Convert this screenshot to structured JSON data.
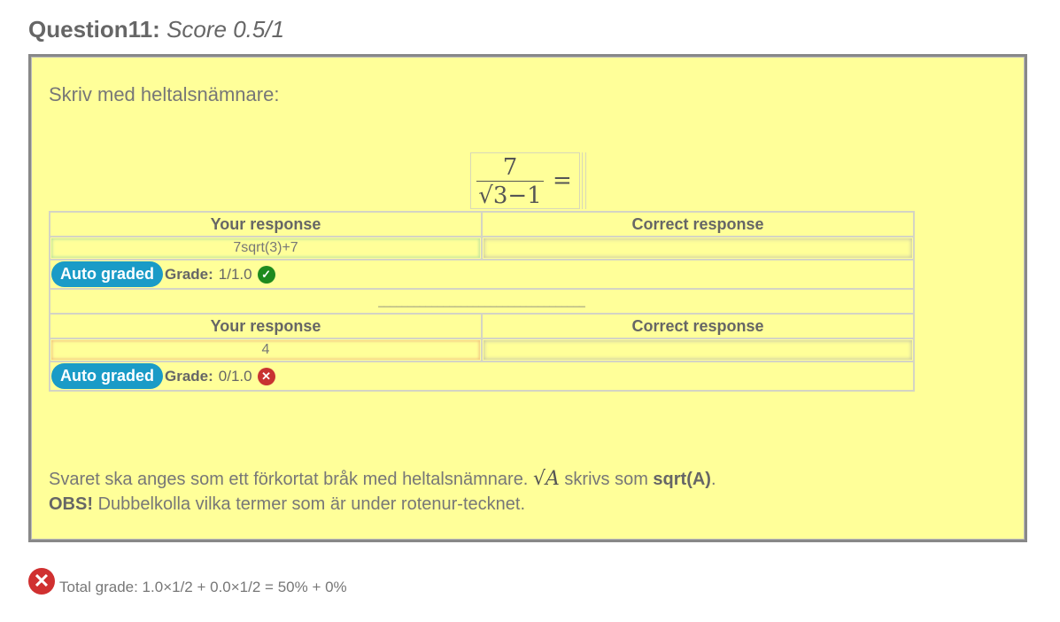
{
  "question": {
    "label": "Question11:",
    "score": "Score 0.5/1"
  },
  "prompt": "Skriv med heltalsnämnare:",
  "formula": {
    "numerator": "7",
    "denominator": "√3−1",
    "equals": "="
  },
  "parts": [
    {
      "your_header": "Your response",
      "correct_header": "Correct response",
      "your_value": "7sqrt(3)+7",
      "correct_value": "",
      "auto_label": "Auto graded",
      "grade_label": "Grade:",
      "grade_value": "1/1.0",
      "status": "correct"
    },
    {
      "your_header": "Your response",
      "correct_header": "Correct response",
      "your_value": "4",
      "correct_value": "",
      "auto_label": "Auto graded",
      "grade_label": "Grade:",
      "grade_value": "0/1.0",
      "status": "incorrect"
    }
  ],
  "separator": "___________________________________",
  "hint": {
    "line1_pre": "Svaret ska anges som ett förkortat bråk med heltalsnämnare.",
    "sqrt_symbol": "√A",
    "line1_mid": "skrivs som",
    "line1_code": "sqrt(A)",
    "line1_end": ".",
    "obs": "OBS!",
    "line2": "Dubbelkolla vilka termer som är under rotenur-tecknet."
  },
  "total": {
    "text": "Total grade: 1.0×1/2 + 0.0×1/2 = 50% + 0%"
  },
  "colors": {
    "box_bg": "#ffff99",
    "auto_badge": "#1a9bc7",
    "ok": "#1e8a1e",
    "bad": "#c83232"
  }
}
